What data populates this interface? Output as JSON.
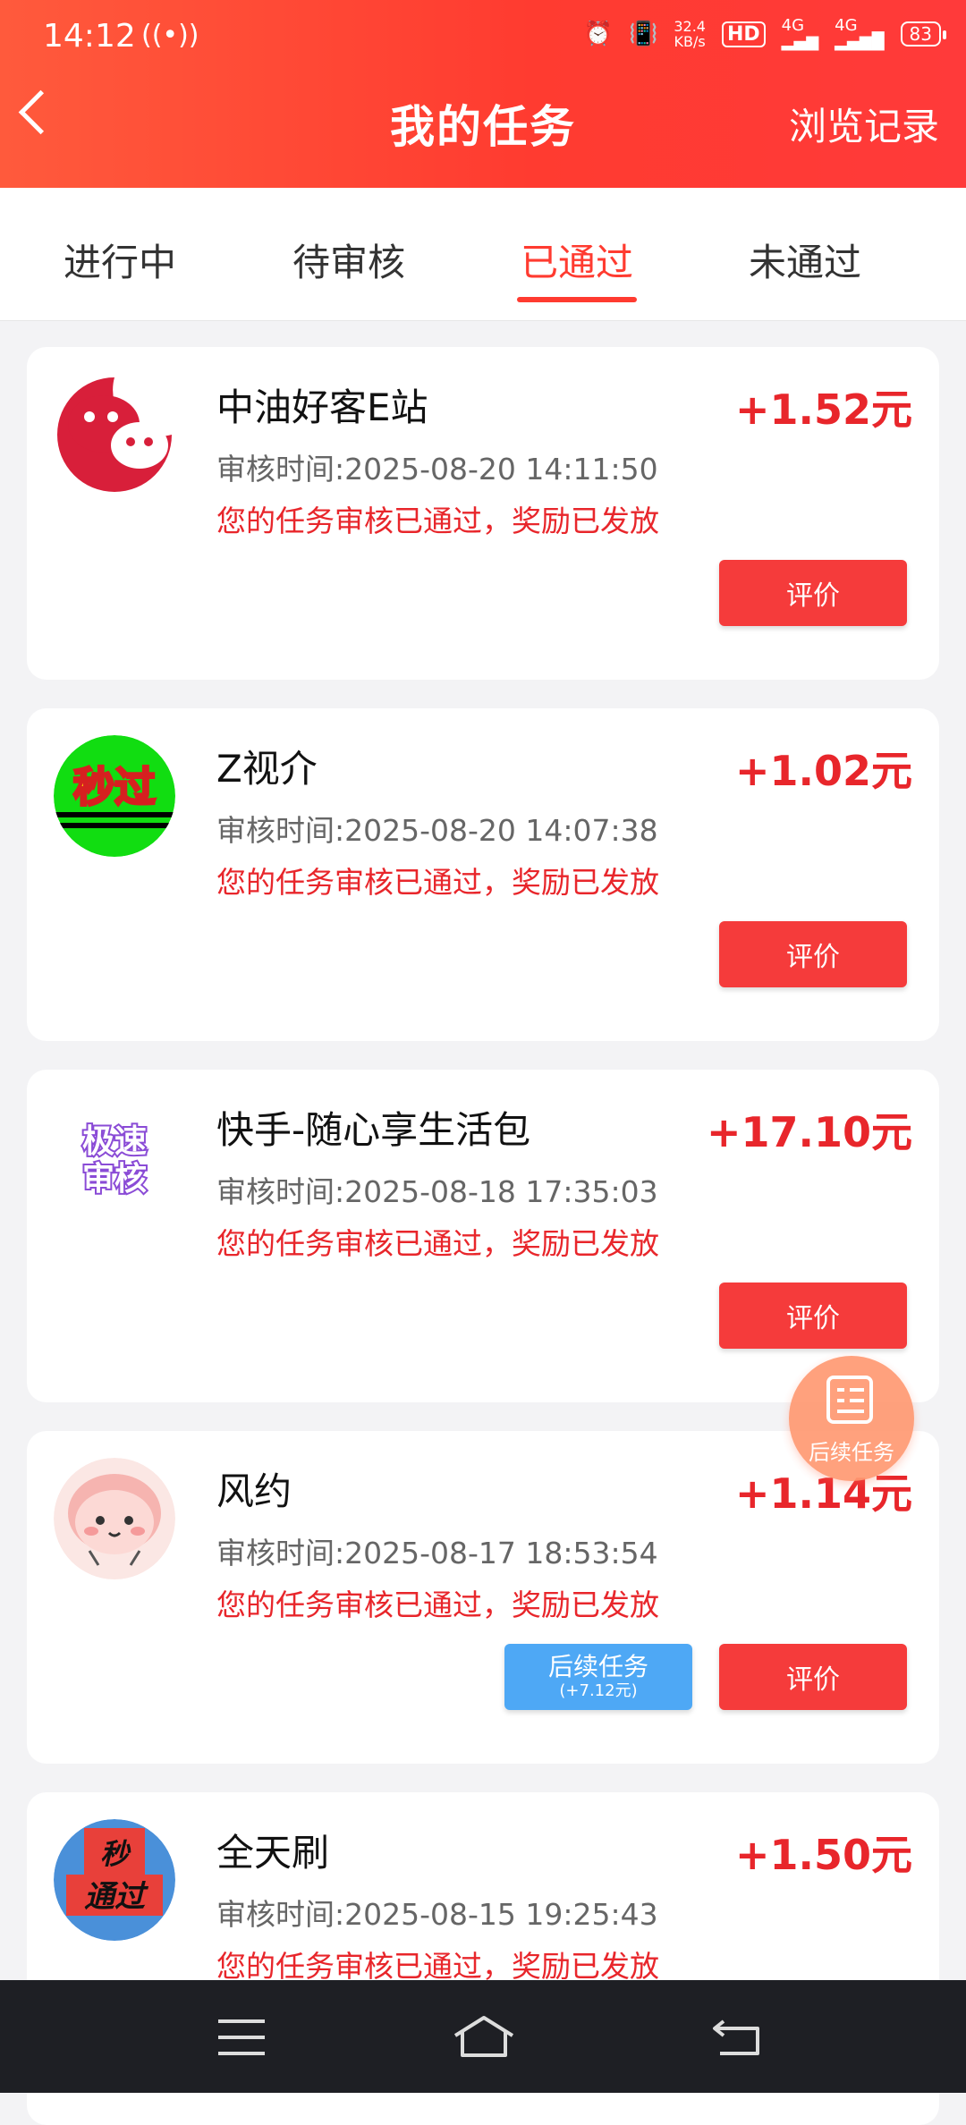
{
  "status_bar": {
    "time": "14:12",
    "net_speed_value": "32.4",
    "net_speed_unit": "KB/s",
    "hd": "HD",
    "net1": "4G",
    "net2": "4G",
    "battery": "83"
  },
  "header": {
    "title": "我的任务",
    "right_link": "浏览记录"
  },
  "tabs": [
    {
      "label": "进行中",
      "active": false
    },
    {
      "label": "待审核",
      "active": false
    },
    {
      "label": "已通过",
      "active": true
    },
    {
      "label": "未通过",
      "active": false
    }
  ],
  "tasks": [
    {
      "name": "中油好客E站",
      "reward": "+1.52元",
      "review_time": "审核时间:2025-08-20 14:11:50",
      "status": "您的任务审核已通过，奖励已发放",
      "review_button": "评价",
      "logo": "wechat-red-icon"
    },
    {
      "name": "Z视介",
      "reward": "+1.02元",
      "review_time": "审核时间:2025-08-20 14:07:38",
      "status": "您的任务审核已通过，奖励已发放",
      "review_button": "评价",
      "logo_text": "秒过"
    },
    {
      "name": "快手-随心享生活包",
      "reward": "+17.10元",
      "review_time": "审核时间:2025-08-18 17:35:03",
      "status": "您的任务审核已通过，奖励已发放",
      "review_button": "评价",
      "logo_text_1": "极速",
      "logo_text_2": "审核"
    },
    {
      "name": "风约",
      "reward": "+1.14元",
      "review_time": "审核时间:2025-08-17 18:53:54",
      "status": "您的任务审核已通过，奖励已发放",
      "review_button": "评价",
      "followup_button": "后续任务",
      "followup_amount": "(+7.12元)",
      "logo": "cartoon-avatar-icon"
    },
    {
      "name": "全天刷",
      "reward": "+1.50元",
      "review_time": "审核时间:2025-08-15 19:25:43",
      "status": "您的任务审核已通过，奖励已发放",
      "logo_text_1": "秒",
      "logo_text_2": "通过"
    }
  ],
  "fab": {
    "label": "后续任务",
    "icon": "document-list-icon"
  },
  "colors": {
    "accent": "#ff3b30",
    "reward": "#e8262b",
    "followup": "#4ea8f5"
  }
}
